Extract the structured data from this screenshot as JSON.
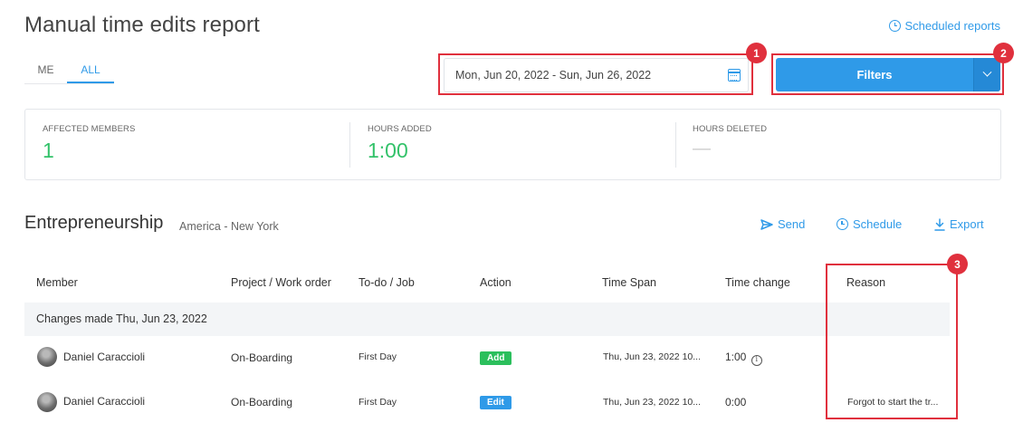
{
  "page": {
    "title": "Manual time edits report",
    "scheduled_reports_label": "Scheduled reports"
  },
  "scope_tabs": [
    {
      "label": "ME",
      "active": false
    },
    {
      "label": "ALL",
      "active": true
    }
  ],
  "date_range": {
    "value": "Mon, Jun 20, 2022 - Sun, Jun 26, 2022",
    "icon": "calendar-icon"
  },
  "filters": {
    "label": "Filters",
    "caret_icon": "chevron-down-icon"
  },
  "annotations": [
    "1",
    "2",
    "3"
  ],
  "stats": [
    {
      "label": "AFFECTED MEMBERS",
      "value": "1"
    },
    {
      "label": "HOURS ADDED",
      "value": "1:00"
    },
    {
      "label": "HOURS DELETED",
      "value": "—"
    }
  ],
  "group": {
    "title": "Entrepreneurship",
    "timezone": "America - New York",
    "actions": [
      {
        "label": "Send",
        "icon": "send-icon"
      },
      {
        "label": "Schedule",
        "icon": "clock-icon"
      },
      {
        "label": "Export",
        "icon": "download-icon"
      }
    ]
  },
  "table": {
    "columns": [
      "Member",
      "Project / Work order",
      "To-do / Job",
      "Action",
      "Time Span",
      "Time change",
      "Reason"
    ],
    "group_label": "Changes made Thu, Jun 23, 2022",
    "rows": [
      {
        "member": "Daniel Caraccioli",
        "project": "On-Boarding",
        "todo": "First Day",
        "action": "Add",
        "time_span": "Thu, Jun 23, 2022 10...",
        "time_change": "1:00",
        "reason": ""
      },
      {
        "member": "Daniel Caraccioli",
        "project": "On-Boarding",
        "todo": "First Day",
        "action": "Edit",
        "time_span": "Thu, Jun 23, 2022 10...",
        "time_change": "0:00",
        "reason": "Forgot to start the tr..."
      }
    ]
  },
  "colors": {
    "accent": "#2f9ae8",
    "success": "#2bbf5c",
    "annotation": "#e0303d"
  }
}
